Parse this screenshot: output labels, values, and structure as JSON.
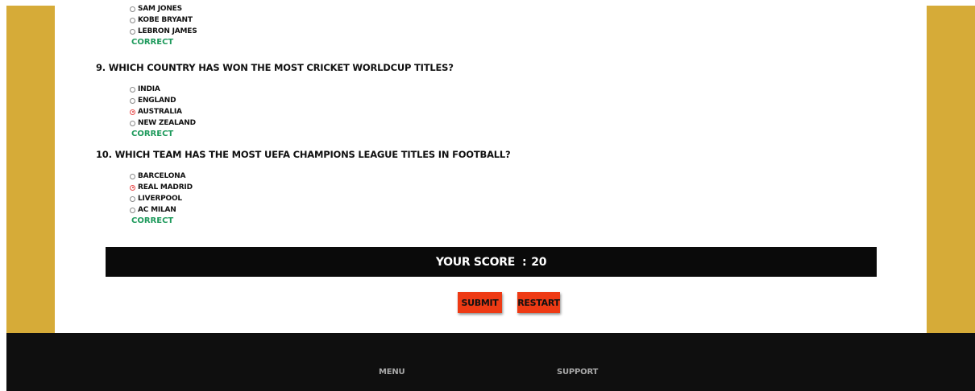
{
  "questions": [
    {
      "title": "",
      "options": [
        "SAM JONES",
        "KOBE BRYANT",
        "LEBRON JAMES"
      ],
      "selected": null,
      "result": "CORRECT"
    },
    {
      "title": "9. WHICH COUNTRY HAS WON THE MOST CRICKET WORLDCUP TITLES?",
      "options": [
        "INDIA",
        "ENGLAND",
        "AUSTRALIA",
        "NEW ZEALAND"
      ],
      "selected": 2,
      "result": "CORRECT"
    },
    {
      "title": "10. WHICH TEAM HAS THE MOST UEFA CHAMPIONS LEAGUE TITLES IN FOOTBALL?",
      "options": [
        "BARCELONA",
        "REAL MADRID",
        "LIVERPOOL",
        "AC MILAN"
      ],
      "selected": 1,
      "result": "CORRECT"
    }
  ],
  "score": {
    "label": "YOUR SCORE",
    "separator": ":",
    "value": "20"
  },
  "buttons": {
    "submit": "SUBMIT",
    "restart": "RESTART"
  },
  "footer": {
    "menu": "MENU",
    "support": "SUPPORT"
  },
  "colors": {
    "gold": "#d6ab38",
    "button": "#ee3a14",
    "correct": "#1e9a5c",
    "footer": "#0f0f0f"
  }
}
